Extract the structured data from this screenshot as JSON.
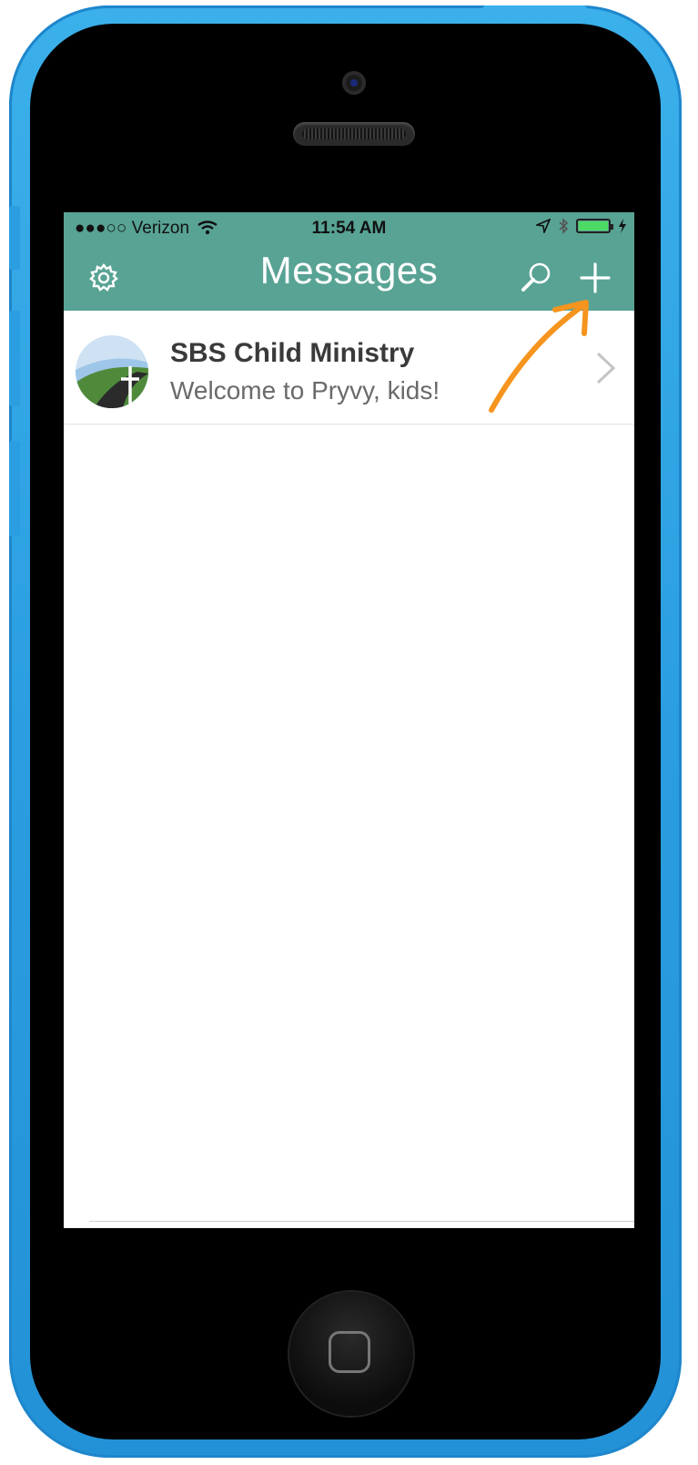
{
  "status_bar": {
    "carrier": "●●●○○ Verizon",
    "time": "11:54 AM"
  },
  "header": {
    "title": "Messages"
  },
  "conversations": [
    {
      "name": "SBS Child Ministry",
      "preview": "Welcome to Pryvy, kids!"
    }
  ],
  "colors": {
    "header_bg": "#58a394",
    "annotation_arrow": "#f5941e",
    "phone_shell": "#2a9ee0"
  },
  "icons": [
    "gear-icon",
    "search-icon",
    "plus-icon",
    "chevron-right-icon",
    "wifi-icon",
    "location-icon",
    "bluetooth-icon",
    "battery-icon"
  ]
}
